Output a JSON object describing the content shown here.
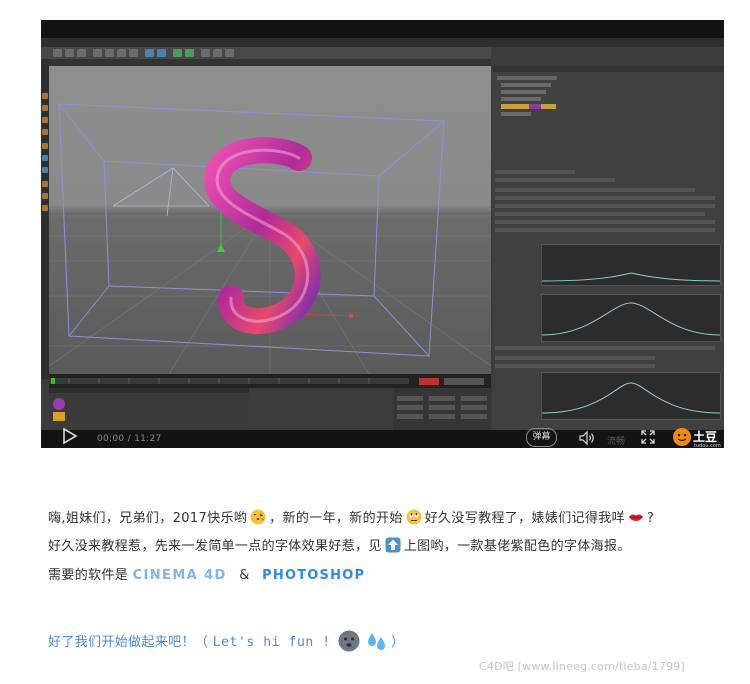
{
  "player": {
    "time": "00:00 / 11:27",
    "danmu_label": "弹幕",
    "quality_label": "流畅",
    "logo_text": "土豆",
    "logo_sub": "tudou.com"
  },
  "viewport": {
    "letter": "S"
  },
  "article": {
    "line1_a": "嗨,姐妹们，兄弟们，2017快乐哟",
    "line1_b": "，新的一年，新的开始",
    "line1_c": "好久没写教程了，婊婊们记得我咩",
    "line1_d": "?",
    "line2_a": "好久没来教程惹，先来一发简单一点的字体效果好惹，见",
    "line2_b": "上图哟，一款基佬紫配色的字体海报。",
    "line3_a": "需要的软件是",
    "software_1": "CINEMA 4D",
    "amp": "&",
    "software_2": "PHOTOSHOP",
    "line4_a": "好了我们开始做起来吧！（",
    "line4_b": "Let's hi fun !",
    "line4_c": "）"
  },
  "watermark": "C4D吧 [www.lineeg.com/tieba/1799]",
  "icons": {
    "play": "play-icon",
    "volume": "volume-icon",
    "fullscreen": "fullscreen-icon"
  }
}
